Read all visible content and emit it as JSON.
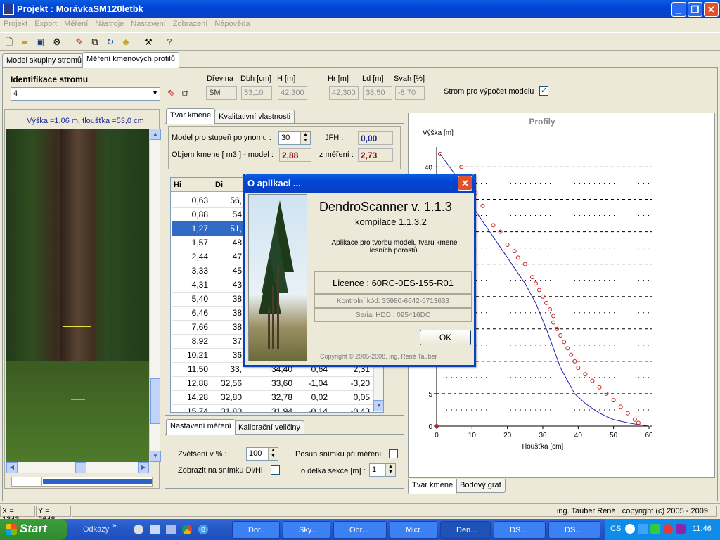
{
  "window": {
    "title": "Projekt : MorávkaSM120letbk"
  },
  "menu": [
    "Projekt",
    "Export",
    "Měření",
    "Nástroje",
    "Nastavení",
    "Zobrazení",
    "Nápověda"
  ],
  "main_tabs": [
    "Model skupiny stromů",
    "Měření kmenových profilů"
  ],
  "ident": {
    "label": "Identifikace stromu",
    "value": "4",
    "drevina_label": "Dřevina",
    "drevina": "SM",
    "dbh_label": "Dbh [cm]",
    "dbh": "53,10",
    "h_label": "H [m]",
    "h": "42,300",
    "hr_label": "Hr [m]",
    "hr": "42,300",
    "ld_label": "Ld [m]",
    "ld": "38,50",
    "svah_label": "Svah [%]",
    "svah": "-8,70",
    "model_label": "Strom pro výpočet modelu",
    "model_checked": "✓"
  },
  "photo": {
    "header": "Výška =1,06 m, tloušťka =53,0 cm"
  },
  "inner_tabs": [
    "Tvar kmene",
    "Kvalitativní vlastnosti"
  ],
  "polynom": {
    "label": "Model pro stupeň polynomu  :",
    "value": "30",
    "jfh_label": "JFH :",
    "jfh": "0,00",
    "objem_label": "Objem kmene [ m3 ]  - model  :",
    "objem_model": "2,88",
    "zmereni_label": "z měření :",
    "objem_mereni": "2,73"
  },
  "table": {
    "headers": [
      "Hi",
      "Di"
    ],
    "rows": [
      [
        "0,63",
        "56,"
      ],
      [
        "0,88",
        "54"
      ],
      [
        "1,27",
        "51,"
      ],
      [
        "1,57",
        "48"
      ],
      [
        "2,44",
        "47"
      ],
      [
        "3,33",
        "45"
      ],
      [
        "4,31",
        "43"
      ],
      [
        "5,40",
        "38"
      ],
      [
        "6,46",
        "38"
      ],
      [
        "7,66",
        "38"
      ],
      [
        "8,92",
        "37"
      ],
      [
        "10,21",
        "36"
      ],
      [
        "11,50",
        "33,",
        "34,40",
        "0,64",
        "2,31"
      ],
      [
        "12,88",
        "32,56",
        "33,60",
        "-1,04",
        "-3,20"
      ],
      [
        "14,28",
        "32,80",
        "32,78",
        "0,02",
        "0,05"
      ],
      [
        "15,74",
        "31,80",
        "31,94",
        "-0,14",
        "-0,43"
      ]
    ]
  },
  "settings_tabs": [
    "Nastavení měření",
    "Kalibrační veličiny"
  ],
  "settings": {
    "zvetseni_label": "Zvětšení v % :",
    "zvetseni": "100",
    "zobrazit_label": "Zobrazit na snímku Di/Hi",
    "posun_label": "Posun snímku při měření",
    "delka_label": "o délka sekce [m] :",
    "delka": "1"
  },
  "chart_tabs": [
    "Tvar kmene",
    "Bodový graf"
  ],
  "chart_data": {
    "type": "scatter",
    "title": "Profily",
    "xlabel": "Tloušťka [cm]",
    "ylabel": "Výška [m]",
    "xlim": [
      0,
      60
    ],
    "ylim": [
      0,
      42
    ],
    "xticks": [
      "0",
      "10",
      "20",
      "30",
      "40",
      "50",
      "60"
    ],
    "yticks": [
      "0",
      "5",
      "10",
      "15",
      "20",
      "25",
      "30",
      "35",
      "40"
    ],
    "points_x": [
      1,
      7,
      11,
      13,
      16,
      18,
      20,
      22,
      23,
      25,
      27,
      28,
      29,
      30,
      31,
      32,
      33,
      33,
      34,
      35,
      36,
      37,
      38,
      39,
      40,
      42,
      44,
      46,
      48,
      50,
      52,
      54,
      56,
      57
    ],
    "points_y": [
      42,
      40,
      36,
      34,
      31,
      30,
      28,
      27,
      26,
      25,
      23,
      22,
      21,
      20,
      19,
      18,
      17,
      16,
      15,
      14,
      13,
      12,
      11,
      10,
      9,
      8,
      7,
      6,
      5,
      4,
      3,
      2,
      1,
      0.5
    ],
    "curve_x": [
      1,
      5,
      10,
      15,
      20,
      25,
      28,
      31,
      33,
      35,
      37,
      39,
      42,
      46,
      50,
      55,
      60
    ],
    "curve_y": [
      42,
      39,
      34,
      30,
      26,
      22,
      19,
      15,
      12,
      9,
      7,
      5,
      3.5,
      2,
      1,
      0.4,
      0
    ],
    "point_color": "#cc2222",
    "curve_color": "#2222aa"
  },
  "dialog": {
    "title": "O aplikaci ...",
    "app_name": "DendroScanner v. 1.1.3",
    "build": "kompilace 1.1.3.2",
    "description": "Aplikace pro tvorbu modelu tvaru kmene lesních porostů.",
    "licence": "Licence : 60RC-0ES-155-R01",
    "control_code": "Kontrolní kód: 35980-6642-5713633",
    "serial": "Serial HDD : 095416DC",
    "ok": "OK",
    "copyright": "Copyright © 2005-2008,  ing. René Tauber"
  },
  "status": {
    "x": "X = 1343",
    "y": "Y = 2648",
    "right": "ing. Tauber René , copyright (c) 2005 - 2009"
  },
  "taskbar": {
    "start": "Start",
    "links": "Odkazy",
    "tasks": [
      "Dor...",
      "Sky...",
      "Obr...",
      "Micr...",
      "Den...",
      "DS...",
      "DS..."
    ],
    "lang": "CS",
    "time": "11:46"
  }
}
